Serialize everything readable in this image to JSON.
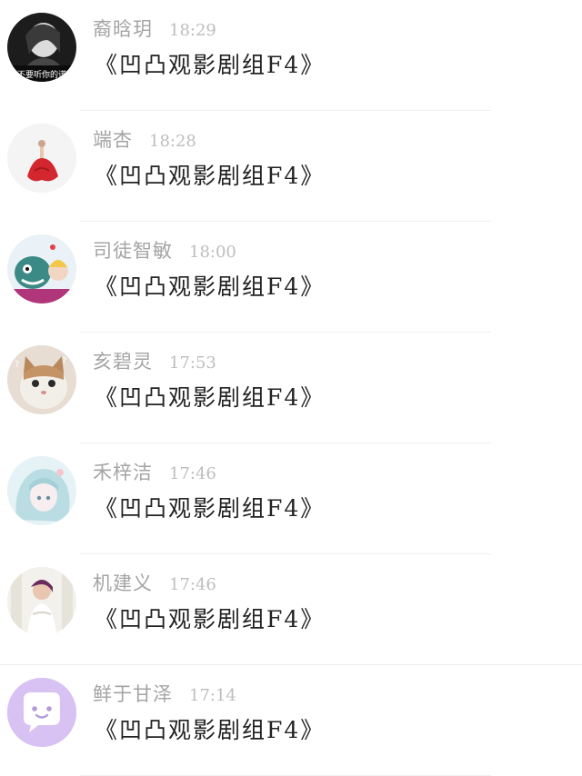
{
  "rows": [
    {
      "name": "裔晗玥",
      "time": "18:29",
      "message": "《凹凸观影剧组F4》",
      "avatar_icon": "avatar-girl-bw",
      "avatar_caption": "才不要听你的谎言"
    },
    {
      "name": "端杏",
      "time": "18:28",
      "message": "《凹凸观影剧组F4》",
      "avatar_icon": "avatar-red-dress"
    },
    {
      "name": "司徒智敏",
      "time": "18:00",
      "message": "《凹凸观影剧组F4》",
      "avatar_icon": "avatar-cartoon-monster"
    },
    {
      "name": "亥碧灵",
      "time": "17:53",
      "message": "《凹凸观影剧组F4》",
      "avatar_icon": "avatar-cat"
    },
    {
      "name": "禾梓洁",
      "time": "17:46",
      "message": "《凹凸观影剧组F4》",
      "avatar_icon": "avatar-anime-girl"
    },
    {
      "name": "机建义",
      "time": "17:46",
      "message": "《凹凸观影剧组F4》",
      "avatar_icon": "avatar-woman-photo"
    },
    {
      "name": "鲜于甘泽",
      "time": "17:14",
      "message": "《凹凸观影剧组F4》",
      "avatar_icon": "avatar-default-chat"
    }
  ],
  "colors": {
    "name": "#a4a4a4",
    "time": "#bdbdbd",
    "message": "#222222",
    "default_avatar": "#d8c2f3"
  }
}
